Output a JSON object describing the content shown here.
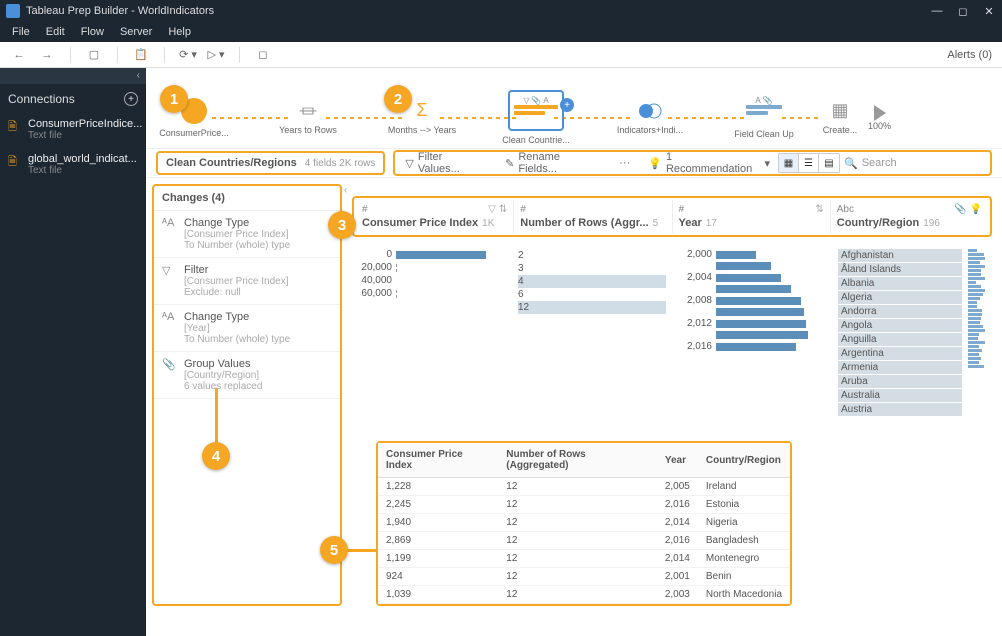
{
  "titlebar": {
    "app": "Tableau Prep Builder",
    "doc": "WorldIndicators"
  },
  "menu": {
    "file": "File",
    "edit": "Edit",
    "flow": "Flow",
    "server": "Server",
    "help": "Help"
  },
  "alerts": "Alerts (0)",
  "sidebar": {
    "title": "Connections",
    "items": [
      {
        "name": "ConsumerPriceIndice...",
        "type": "Text file"
      },
      {
        "name": "global_world_indicat...",
        "type": "Text file"
      }
    ]
  },
  "flow": {
    "nodes": [
      "ConsumerPrice...",
      "Years to Rows",
      "Months --> Years",
      "Clean Countrie...",
      "Indicators+Indi...",
      "Field Clean Up",
      "Create..."
    ],
    "endPercent": "100%"
  },
  "step": {
    "name": "Clean Countries/Regions",
    "meta": "4 fields   2K rows",
    "filter": "Filter Values...",
    "rename": "Rename Fields...",
    "more": "···",
    "recommend": "1 Recommendation",
    "search": "Search"
  },
  "changes": {
    "title": "Changes (4)",
    "items": [
      {
        "title": "Change Type",
        "sub1": "[Consumer Price Index]",
        "sub2": "To Number (whole) type"
      },
      {
        "title": "Filter",
        "sub1": "[Consumer Price Index]",
        "sub2": "Exclude: null"
      },
      {
        "title": "Change Type",
        "sub1": "[Year]",
        "sub2": "To Number (whole) type"
      },
      {
        "title": "Group Values",
        "sub1": "[Country/Region]",
        "sub2": "6 values replaced"
      }
    ]
  },
  "profile": {
    "cols": [
      {
        "type": "#",
        "name": "Consumer Price Index",
        "count": "1K"
      },
      {
        "type": "#",
        "name": "Number of Rows (Aggr...",
        "count": "5"
      },
      {
        "type": "#",
        "name": "Year",
        "count": "17"
      },
      {
        "type": "Abc",
        "name": "Country/Region",
        "count": "196"
      }
    ],
    "cpiAxis": [
      "0",
      "20,000",
      "40,000",
      "60,000"
    ],
    "rowsVals": [
      "2",
      "3",
      "4",
      "6",
      "12"
    ],
    "yearAxis": [
      "2,000",
      "2,004",
      "2,008",
      "2,012",
      "2,016"
    ],
    "countries": [
      "Afghanistan",
      "Åland Islands",
      "Albania",
      "Algeria",
      "Andorra",
      "Angola",
      "Anguilla",
      "Argentina",
      "Armenia",
      "Aruba",
      "Australia",
      "Austria"
    ]
  },
  "table": {
    "headers": [
      "Consumer Price Index",
      "Number of Rows (Aggregated)",
      "Year",
      "Country/Region"
    ],
    "rows": [
      [
        "1,228",
        "12",
        "2,005",
        "Ireland"
      ],
      [
        "2,245",
        "12",
        "2,016",
        "Estonia"
      ],
      [
        "1,940",
        "12",
        "2,014",
        "Nigeria"
      ],
      [
        "2,869",
        "12",
        "2,016",
        "Bangladesh"
      ],
      [
        "1,199",
        "12",
        "2,014",
        "Montenegro"
      ],
      [
        "924",
        "12",
        "2,001",
        "Benin"
      ],
      [
        "1,039",
        "12",
        "2,003",
        "North Macedonia"
      ]
    ]
  },
  "callouts": [
    "1",
    "2",
    "3",
    "4",
    "5"
  ],
  "chart_data": {
    "type": "table",
    "title": "Clean Countries/Regions profile & data grid",
    "fields": [
      {
        "name": "Consumer Price Index",
        "role": "measure",
        "distinct": "1K",
        "range_shown": [
          0,
          60000
        ],
        "distribution": "heavily right-skewed (almost all values near 0)"
      },
      {
        "name": "Number of Rows (Aggregated)",
        "role": "measure",
        "distinct": 5,
        "values_shown": [
          2,
          3,
          4,
          6,
          12
        ]
      },
      {
        "name": "Year",
        "role": "dimension",
        "distinct": 17,
        "range_shown": [
          2000,
          2016
        ],
        "distribution": "roughly uniform with slight increase mid-range"
      },
      {
        "name": "Country/Region",
        "role": "dimension",
        "distinct": 196
      }
    ],
    "sample_rows": [
      {
        "Consumer Price Index": 1228,
        "Number of Rows (Aggregated)": 12,
        "Year": 2005,
        "Country/Region": "Ireland"
      },
      {
        "Consumer Price Index": 2245,
        "Number of Rows (Aggregated)": 12,
        "Year": 2016,
        "Country/Region": "Estonia"
      },
      {
        "Consumer Price Index": 1940,
        "Number of Rows (Aggregated)": 12,
        "Year": 2014,
        "Country/Region": "Nigeria"
      },
      {
        "Consumer Price Index": 2869,
        "Number of Rows (Aggregated)": 12,
        "Year": 2016,
        "Country/Region": "Bangladesh"
      },
      {
        "Consumer Price Index": 1199,
        "Number of Rows (Aggregated)": 12,
        "Year": 2014,
        "Country/Region": "Montenegro"
      },
      {
        "Consumer Price Index": 924,
        "Number of Rows (Aggregated)": 12,
        "Year": 2001,
        "Country/Region": "Benin"
      },
      {
        "Consumer Price Index": 1039,
        "Number of Rows (Aggregated)": 12,
        "Year": 2003,
        "Country/Region": "North Macedonia"
      }
    ]
  }
}
